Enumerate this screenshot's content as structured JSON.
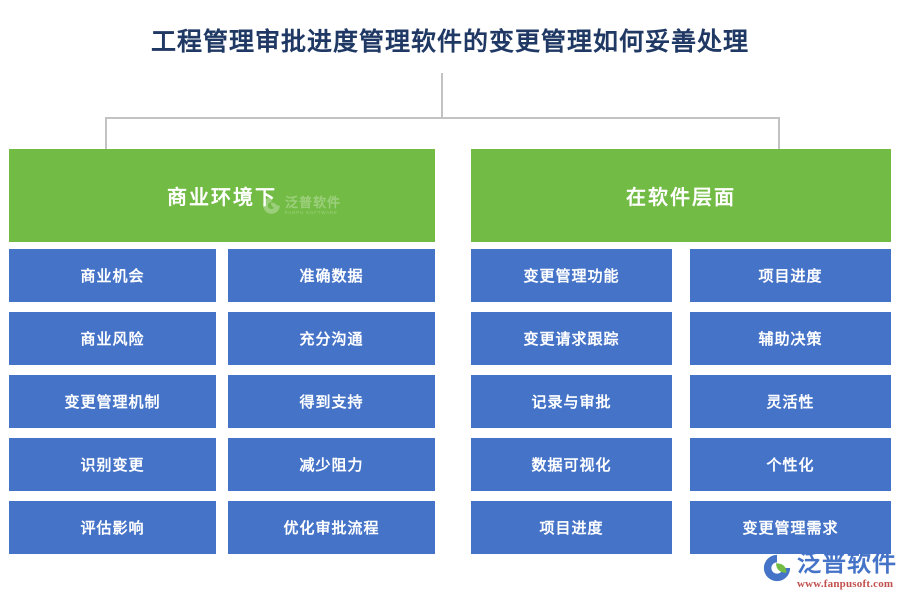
{
  "page": {
    "title": "工程管理审批进度管理软件的变更管理如何妥善处理",
    "background_color": "#ffffff"
  },
  "theme": {
    "title_color": "#1f3864",
    "group_color": "#72bb44",
    "leaf_color": "#4573c8",
    "connector_color": "#c2c2c2",
    "leaf_text_color": "#ffffff",
    "brand_color": "#4573c8",
    "brand_url_color": "#c0504d"
  },
  "diagram": {
    "groups": [
      {
        "label": "商业环境下",
        "items": [
          {
            "label": "商业机会"
          },
          {
            "label": "商业风险"
          },
          {
            "label": "变更管理机制"
          },
          {
            "label": "识别变更"
          },
          {
            "label": "评估影响"
          }
        ],
        "items2": [
          {
            "label": "准确数据"
          },
          {
            "label": "充分沟通"
          },
          {
            "label": "得到支持"
          },
          {
            "label": "减少阻力"
          },
          {
            "label": "优化审批流程"
          }
        ]
      },
      {
        "label": "在软件层面",
        "items": [
          {
            "label": "变更管理功能"
          },
          {
            "label": "变更请求跟踪"
          },
          {
            "label": "记录与审批"
          },
          {
            "label": "数据可视化"
          },
          {
            "label": "项目进度"
          }
        ],
        "items2": [
          {
            "label": "项目进度"
          },
          {
            "label": "辅助决策"
          },
          {
            "label": "灵活性"
          },
          {
            "label": "个性化"
          },
          {
            "label": "变更管理需求"
          }
        ]
      }
    ]
  },
  "watermark": {
    "name_cn": "泛普软件",
    "name_en": "FANPU SOFTWARE"
  },
  "brand": {
    "name_cn": "泛普软件",
    "url": "www.fanpusoft.com"
  }
}
